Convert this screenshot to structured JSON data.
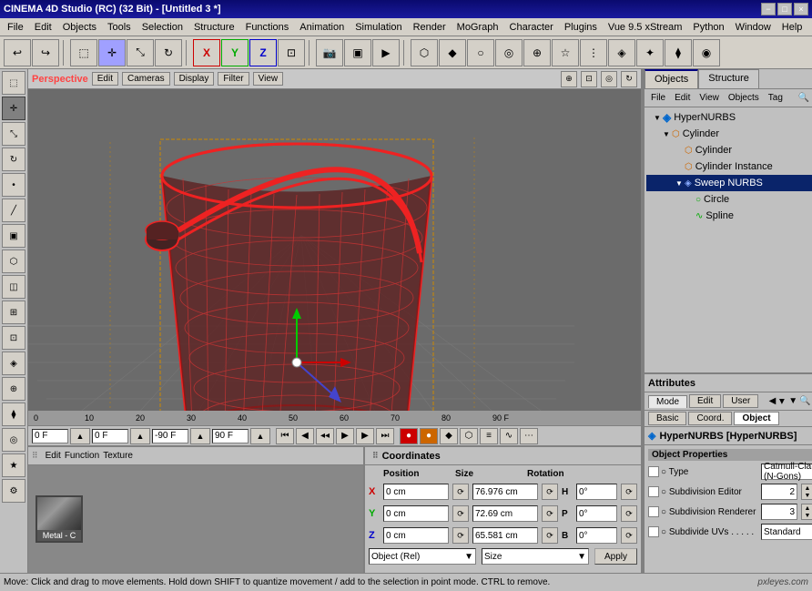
{
  "titlebar": {
    "title": "CINEMA 4D Studio (RC) (32 Bit) - [Untitled 3 *]",
    "minimize": "−",
    "maximize": "□",
    "close": "×"
  },
  "menubar": {
    "items": [
      "File",
      "Edit",
      "Objects",
      "Tools",
      "Selection",
      "Structure",
      "Functions",
      "Animation",
      "Simulation",
      "Render",
      "MoGraph",
      "Character",
      "Plugins",
      "Vue 9.5 xStream",
      "Python",
      "Window",
      "Help"
    ]
  },
  "toolbar": {
    "groups": [
      "undo",
      "redo",
      "select",
      "move",
      "scale",
      "rotate",
      "xyz",
      "camera",
      "render",
      "simulation",
      "mograph"
    ]
  },
  "viewport": {
    "label": "Perspective",
    "toolbar_items": [
      "Edit",
      "Cameras",
      "Display",
      "Filter",
      "View"
    ]
  },
  "timeline": {
    "start": "0 F",
    "end": "90 F",
    "current_start": "0 F",
    "current_end": "90 F",
    "markers": [
      "0",
      "10",
      "20",
      "30",
      "40",
      "50",
      "60",
      "70",
      "80",
      "90 F"
    ]
  },
  "objects_panel": {
    "tabs": [
      "Objects",
      "Structure"
    ],
    "toolbar": [
      "File",
      "Edit",
      "View",
      "Objects",
      "Tag"
    ],
    "tree": [
      {
        "label": "HyperNURBS",
        "indent": 0,
        "icon": "hn",
        "expanded": true,
        "type": "nurbs"
      },
      {
        "label": "Cylinder",
        "indent": 1,
        "icon": "cyl",
        "expanded": true,
        "type": "obj"
      },
      {
        "label": "Cylinder",
        "indent": 2,
        "icon": "cyl",
        "type": "obj"
      },
      {
        "label": "Cylinder Instance",
        "indent": 2,
        "icon": "cyl",
        "type": "obj"
      },
      {
        "label": "Sweep NURBS",
        "indent": 2,
        "icon": "sweep",
        "expanded": true,
        "type": "nurbs",
        "selected": true
      },
      {
        "label": "Circle",
        "indent": 3,
        "icon": "circle",
        "type": "spline"
      },
      {
        "label": "Spline",
        "indent": 3,
        "icon": "spline",
        "type": "spline"
      }
    ]
  },
  "materials_panel": {
    "toolbar": [
      "Edit",
      "Function",
      "Texture"
    ],
    "material_name": "Metal - C"
  },
  "coordinates": {
    "title": "Coordinates",
    "position_label": "Position",
    "size_label": "Size",
    "rotation_label": "Rotation",
    "x_pos": "0 cm",
    "y_pos": "0 cm",
    "z_pos": "0 cm",
    "x_size": "76.976 cm",
    "y_size": "72.69 cm",
    "z_size": "65.581 cm",
    "x_rot_label": "H",
    "y_rot_label": "P",
    "z_rot_label": "B",
    "x_rot": "0°",
    "y_rot": "0°",
    "z_rot": "0°",
    "pos_dropdown": "Object (Rel)",
    "size_dropdown": "Size",
    "apply_btn": "Apply"
  },
  "attributes": {
    "header": "Attributes",
    "tabs": [
      "Mode",
      "Edit",
      "User"
    ],
    "subtabs": [
      "Basic",
      "Coord.",
      "Object"
    ],
    "active_subtab": "Object",
    "title": "HyperNURBS [HyperNURBS]",
    "section": "Object Properties",
    "type_label": "○ Type",
    "type_value": "Catmull-Clark (N-Gons)",
    "subdiv_editor_label": "○ Subdivision Editor",
    "subdiv_editor_value": "2",
    "subdiv_renderer_label": "○ Subdivision Renderer",
    "subdiv_renderer_value": "3",
    "subdiv_uvs_label": "○ Subdivide UVs . . . . .",
    "subdiv_uvs_value": "Standard"
  },
  "statusbar": {
    "message": "Move: Click and drag to move elements. Hold down SHIFT to quantize movement / add to the selection in point mode. CTRL to remove.",
    "credit": "pxleyes.com"
  }
}
